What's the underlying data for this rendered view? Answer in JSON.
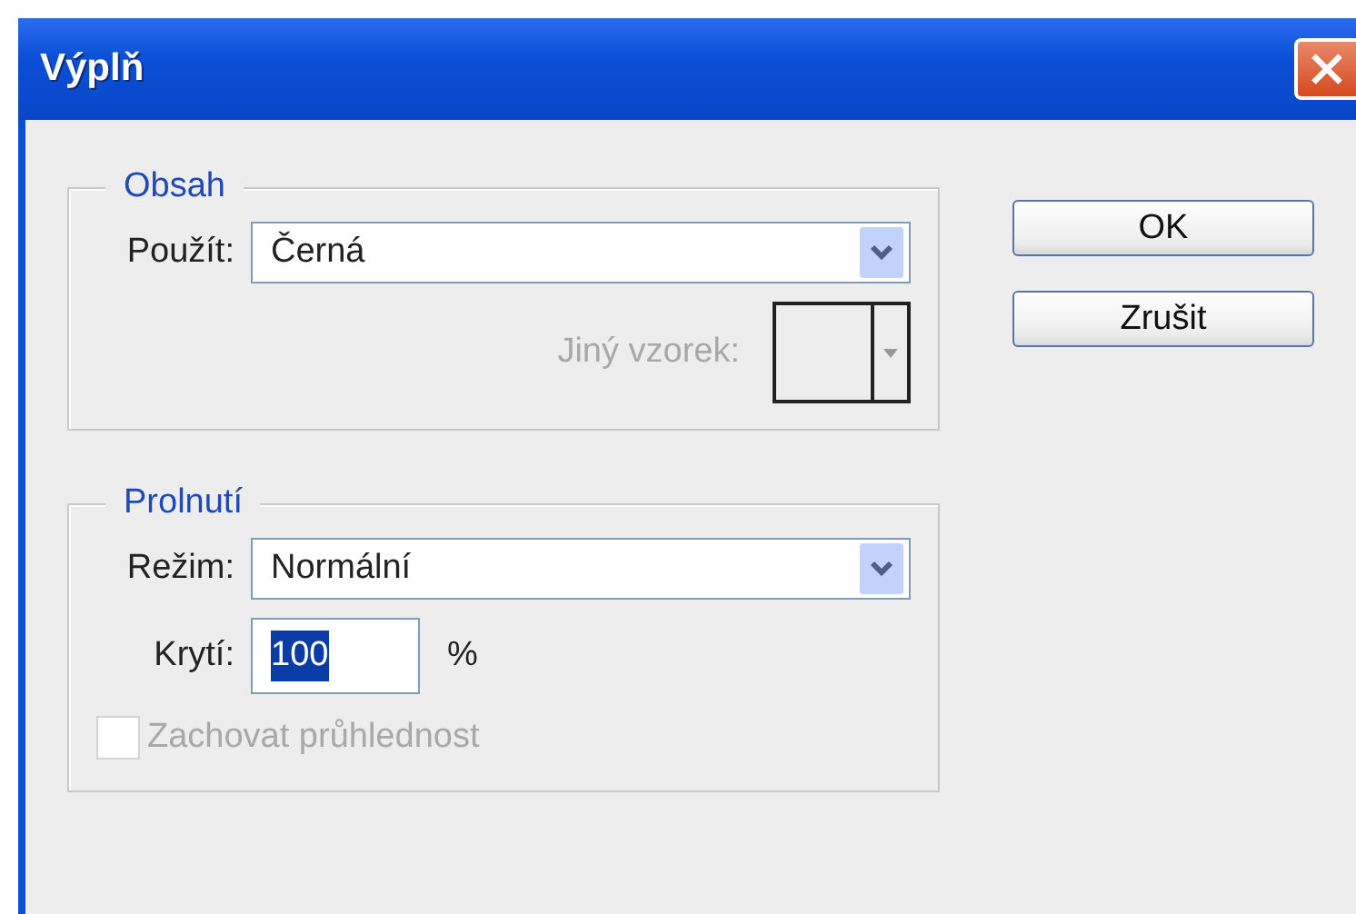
{
  "window": {
    "title": "Výplň"
  },
  "groups": [
    {
      "title": "Obsah",
      "rows": [
        {
          "kind": "select",
          "label": "Použít:",
          "value": "Černá"
        },
        {
          "kind": "swatch",
          "label": "Jiný vzorek:",
          "disabled": true
        }
      ]
    },
    {
      "title": "Prolnutí",
      "rows": [
        {
          "kind": "select",
          "label": "Režim:",
          "value": "Normální"
        },
        {
          "kind": "number",
          "label": "Krytí:",
          "value": "100",
          "unit": "%",
          "text_selected": true
        },
        {
          "kind": "checkbox",
          "label": "Zachovat průhlednost",
          "checked": false,
          "disabled": true
        }
      ]
    }
  ],
  "buttons": [
    {
      "label": "OK"
    },
    {
      "label": "Zrušit"
    }
  ]
}
